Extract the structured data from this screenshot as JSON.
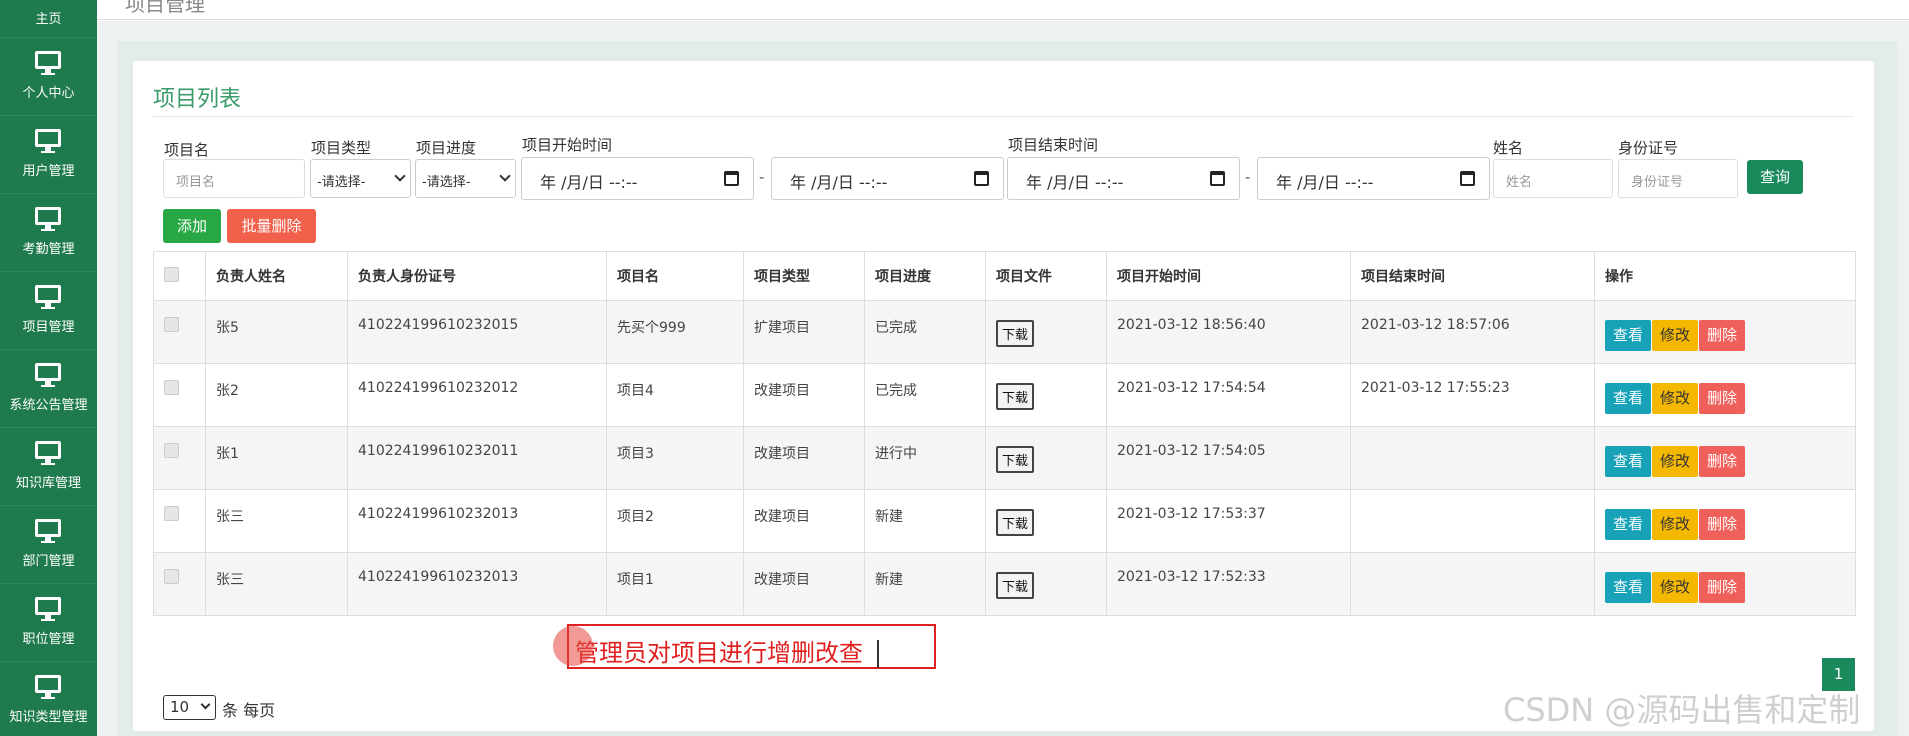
{
  "topbar": {
    "title": "项目管理"
  },
  "sidebar": {
    "home": "主页",
    "items": [
      {
        "label": "个人中心",
        "icon": "monitor-icon"
      },
      {
        "label": "用户管理",
        "icon": "monitor-icon"
      },
      {
        "label": "考勤管理",
        "icon": "monitor-icon"
      },
      {
        "label": "项目管理",
        "icon": "monitor-icon"
      },
      {
        "label": "系统公告管理",
        "icon": "monitor-icon"
      },
      {
        "label": "知识库管理",
        "icon": "monitor-icon"
      },
      {
        "label": "部门管理",
        "icon": "monitor-icon"
      },
      {
        "label": "职位管理",
        "icon": "monitor-icon"
      },
      {
        "label": "知识类型管理",
        "icon": "monitor-icon"
      }
    ]
  },
  "panel": {
    "title": "项目列表"
  },
  "filters": {
    "name_label": "项目名",
    "name_placeholder": "项目名",
    "type_label": "项目类型",
    "type_value": "-请选择-",
    "progress_label": "项目进度",
    "progress_value": "-请选择-",
    "start_label": "项目开始时间",
    "end_label": "项目结束时间",
    "date_placeholder": "年 /月/日 --:--",
    "range_sep": "-",
    "person_label": "姓名",
    "person_placeholder": "姓名",
    "id_label": "身份证号",
    "id_placeholder": "身份证号",
    "search_button": "查询"
  },
  "actions": {
    "add": "添加",
    "batch_delete": "批量删除"
  },
  "table": {
    "headers": [
      "负责人姓名",
      "负责人身份证号",
      "项目名",
      "项目类型",
      "项目进度",
      "项目文件",
      "项目开始时间",
      "项目结束时间",
      "操作"
    ],
    "download_label": "下载",
    "view_label": "查看",
    "edit_label": "修改",
    "delete_label": "删除",
    "rows": [
      {
        "name": "张5",
        "id": "410224199610232015",
        "project": "先买个999",
        "type": "扩建项目",
        "progress": "已完成",
        "start": "2021-03-12 18:56:40",
        "end": "2021-03-12 18:57:06"
      },
      {
        "name": "张2",
        "id": "410224199610232012",
        "project": "项目4",
        "type": "改建项目",
        "progress": "已完成",
        "start": "2021-03-12 17:54:54",
        "end": "2021-03-12 17:55:23"
      },
      {
        "name": "张1",
        "id": "410224199610232011",
        "project": "项目3",
        "type": "改建项目",
        "progress": "进行中",
        "start": "2021-03-12 17:54:05",
        "end": ""
      },
      {
        "name": "张三",
        "id": "410224199610232013",
        "project": "项目2",
        "type": "改建项目",
        "progress": "新建",
        "start": "2021-03-12 17:53:37",
        "end": ""
      },
      {
        "name": "张三",
        "id": "410224199610232013",
        "project": "项目1",
        "type": "改建项目",
        "progress": "新建",
        "start": "2021-03-12 17:52:33",
        "end": ""
      }
    ]
  },
  "pager": {
    "page_size": "10",
    "per_page_text": "条 每页",
    "current_page": "1"
  },
  "caption": "管理员对项目进行增删改查",
  "watermark": "CSDN @源码出售和定制",
  "colors": {
    "sidebar": "#1f7a4d",
    "accent": "#1a8a5c",
    "title": "#3a9a6a"
  }
}
